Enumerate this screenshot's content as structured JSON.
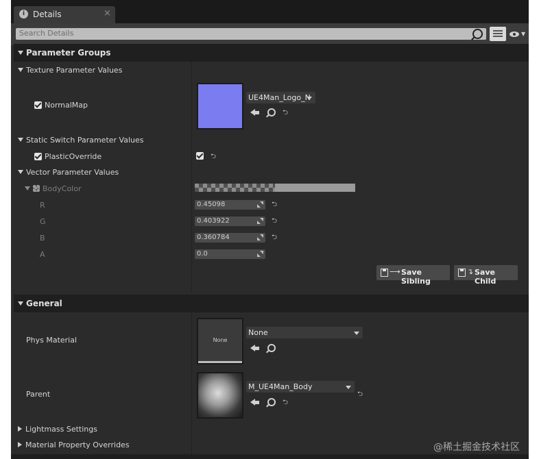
{
  "tab": {
    "title": "Details",
    "close": "×",
    "info_glyph": "i"
  },
  "search": {
    "placeholder": "Search Details"
  },
  "categories": {
    "parameter_groups": "Parameter Groups",
    "general": "General"
  },
  "texture_params": {
    "header": "Texture Parameter Values",
    "normal_map_label": "NormalMap",
    "normal_map_checked": true,
    "texture_value": "UE4Man_Logo_N"
  },
  "static_switch": {
    "header": "Static Switch Parameter Values",
    "plastic_label": "PlasticOverride",
    "plastic_checked": true,
    "value_checked": true
  },
  "vector_params": {
    "header": "Vector Parameter Values",
    "body_color_label": "BodyColor",
    "channels": [
      {
        "label": "R",
        "value": "0.45098"
      },
      {
        "label": "G",
        "value": "0.403922"
      },
      {
        "label": "B",
        "value": "0.360784"
      },
      {
        "label": "A",
        "value": "0.0"
      }
    ]
  },
  "buttons": {
    "save_sibling": "Save Sibling",
    "save_child": "Save Child"
  },
  "general": {
    "phys_material_label": "Phys Material",
    "phys_material_value": "None",
    "phys_thumb_text": "None",
    "parent_label": "Parent",
    "parent_value": "M_UE4Man_Body"
  },
  "collapsed_sections": {
    "lightmass": "Lightmass Settings",
    "overrides": "Material Property Overrides"
  },
  "watermark": "@稀土掘金技术社区",
  "colors": {
    "panel_bg": "#2b2b2b",
    "category_bar": "#1f1f1f",
    "normal_map_thumb": "#7a7cf0",
    "body_color": "#736759"
  }
}
